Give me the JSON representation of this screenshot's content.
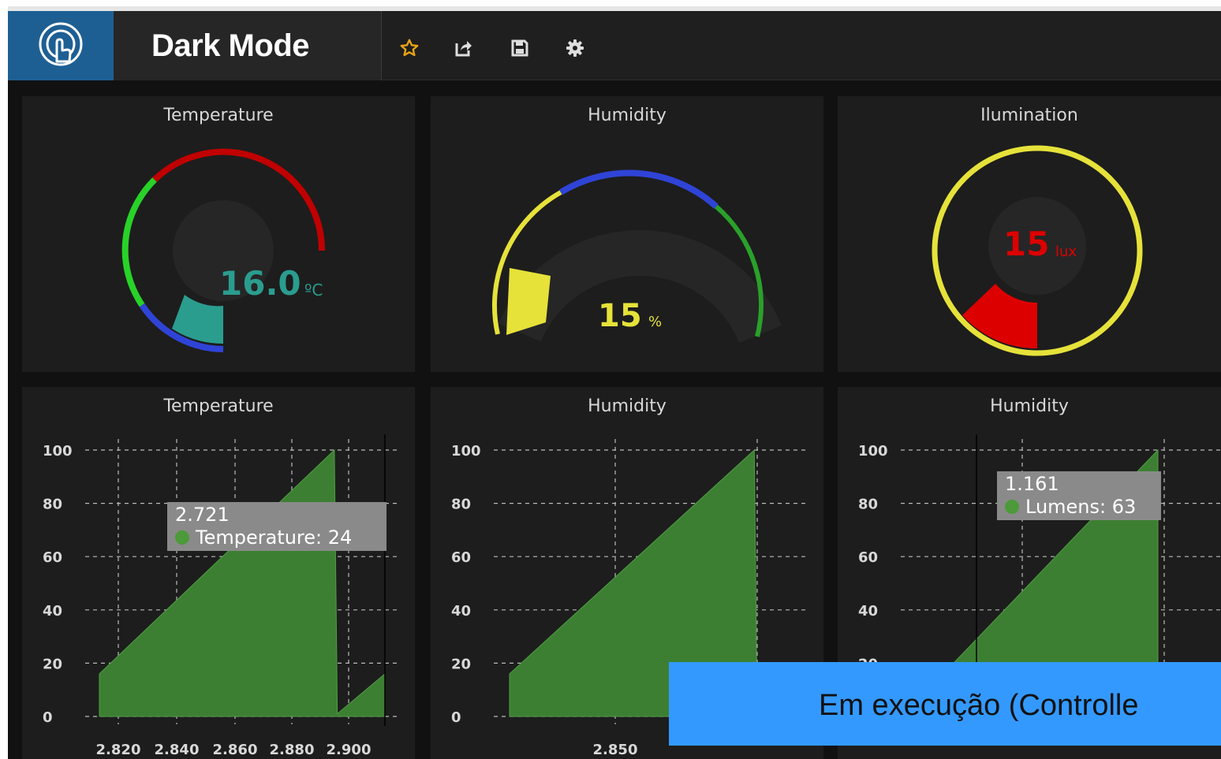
{
  "header": {
    "title": "Dark Mode",
    "icons": [
      "app-logo-icon",
      "star-icon",
      "share-icon",
      "save-icon",
      "gear-icon"
    ],
    "accent_color": "#1e5f93",
    "star_color": "#e8a317"
  },
  "gauges": [
    {
      "title": "Temperature",
      "value": "16.0",
      "unit": "ºC",
      "value_color": "#2a9d8f"
    },
    {
      "title": "Humidity",
      "value": "15",
      "unit": "%",
      "value_color": "#e6e23a"
    },
    {
      "title": "Ilumination",
      "value": "15",
      "unit": "lux",
      "value_color": "#dd0000"
    }
  ],
  "charts": [
    {
      "title": "Temperature",
      "tooltip": {
        "x": "2.721",
        "series": "Temperature: 24"
      }
    },
    {
      "title": "Humidity"
    },
    {
      "title": "Humidity",
      "tooltip": {
        "x": "1.161",
        "series": "Lumens: 63"
      }
    }
  ],
  "chart_data": [
    {
      "type": "area",
      "title": "Temperature",
      "ylim": [
        0,
        100
      ],
      "y_ticks": [
        "0",
        "20",
        "40",
        "60",
        "80",
        "100"
      ],
      "x_ticks": [
        "2.820",
        "2.840",
        "2.860",
        "2.880",
        "2.900"
      ],
      "color": "#3c7f32",
      "series": [
        {
          "name": "Temperature",
          "x": [
            2.815,
            2.894,
            2.895,
            2.911
          ],
          "values": [
            16,
            100,
            1,
            16
          ]
        }
      ]
    },
    {
      "type": "area",
      "title": "Humidity",
      "ylim": [
        0,
        100
      ],
      "y_ticks": [
        "0",
        "20",
        "40",
        "60",
        "80",
        "100"
      ],
      "x_ticks": [
        "2.850"
      ],
      "color": "#3c7f32",
      "series": [
        {
          "x": [
            2.813,
            2.897,
            2.898
          ],
          "values": [
            16,
            100,
            0
          ]
        }
      ]
    },
    {
      "type": "area",
      "title": "Humidity",
      "ylim": [
        0,
        100
      ],
      "y_ticks": [
        "20",
        "40",
        "60",
        "80",
        "100"
      ],
      "x_ticks": [],
      "color": "#3c7f32",
      "series": [
        {
          "name": "Lumens",
          "x": [
            1.1,
            1.3
          ],
          "values": [
            8,
            100
          ]
        }
      ]
    }
  ],
  "status_banner": {
    "text": "Em execução (Controlle",
    "color": "#3399ff"
  }
}
